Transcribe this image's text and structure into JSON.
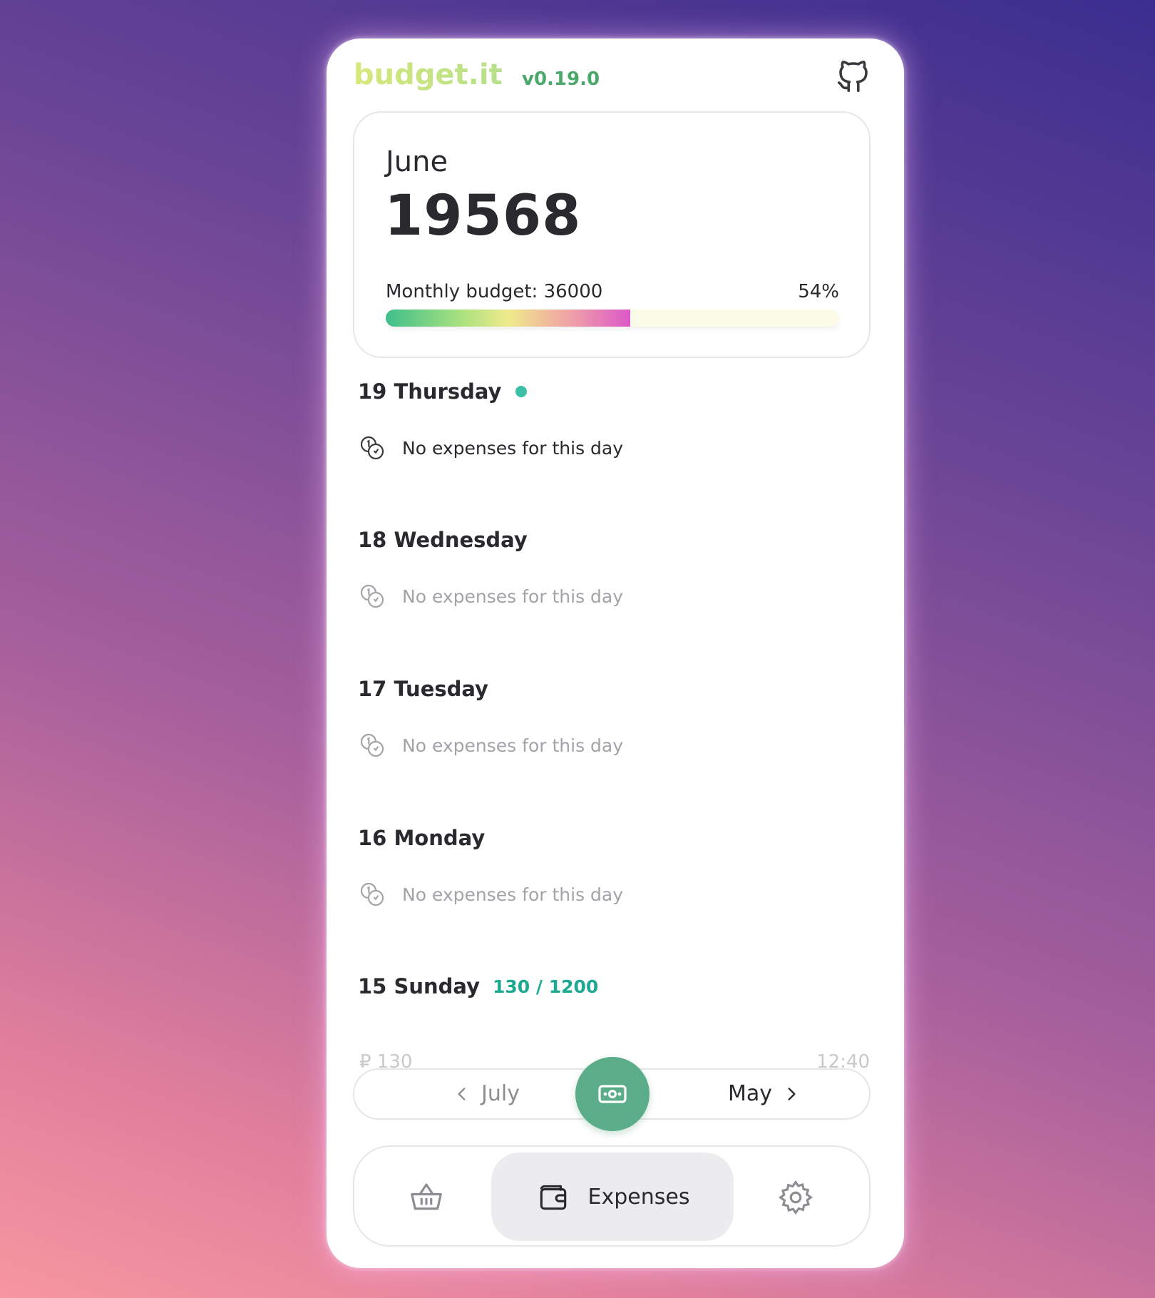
{
  "app": {
    "name": "budget.it",
    "version": "v0.19.0",
    "github_icon": "github-icon"
  },
  "summary": {
    "month": "June",
    "total": "19568",
    "budget_label": "Monthly budget: 36000",
    "percent_label": "54%",
    "progress_fraction": 0.54
  },
  "days": [
    {
      "title": "19 Thursday",
      "today": true,
      "spent": "",
      "message": "No expenses for this day",
      "faded": false
    },
    {
      "title": "18 Wednesday",
      "today": false,
      "spent": "",
      "message": "No expenses for this day",
      "faded": true
    },
    {
      "title": "17 Tuesday",
      "today": false,
      "spent": "",
      "message": "No expenses for this day",
      "faded": true
    },
    {
      "title": "16 Monday",
      "today": false,
      "spent": "",
      "message": "No expenses for this day",
      "faded": true
    },
    {
      "title": "15 Sunday",
      "today": false,
      "spent": "130 / 1200",
      "message": "",
      "faded": false
    }
  ],
  "peek_entry": {
    "amount": "₽ 130",
    "time": "12:40"
  },
  "month_nav": {
    "prev": "July",
    "next": "May",
    "center_icon": "cash-icon"
  },
  "bottom_nav": {
    "basket_icon": "basket-icon",
    "expenses_label": "Expenses",
    "expenses_icon": "wallet-icon",
    "settings_icon": "gear-icon"
  },
  "colors": {
    "accent": "#5aad88",
    "spent": "#1da892",
    "today_dot": "#3bbfa7"
  }
}
